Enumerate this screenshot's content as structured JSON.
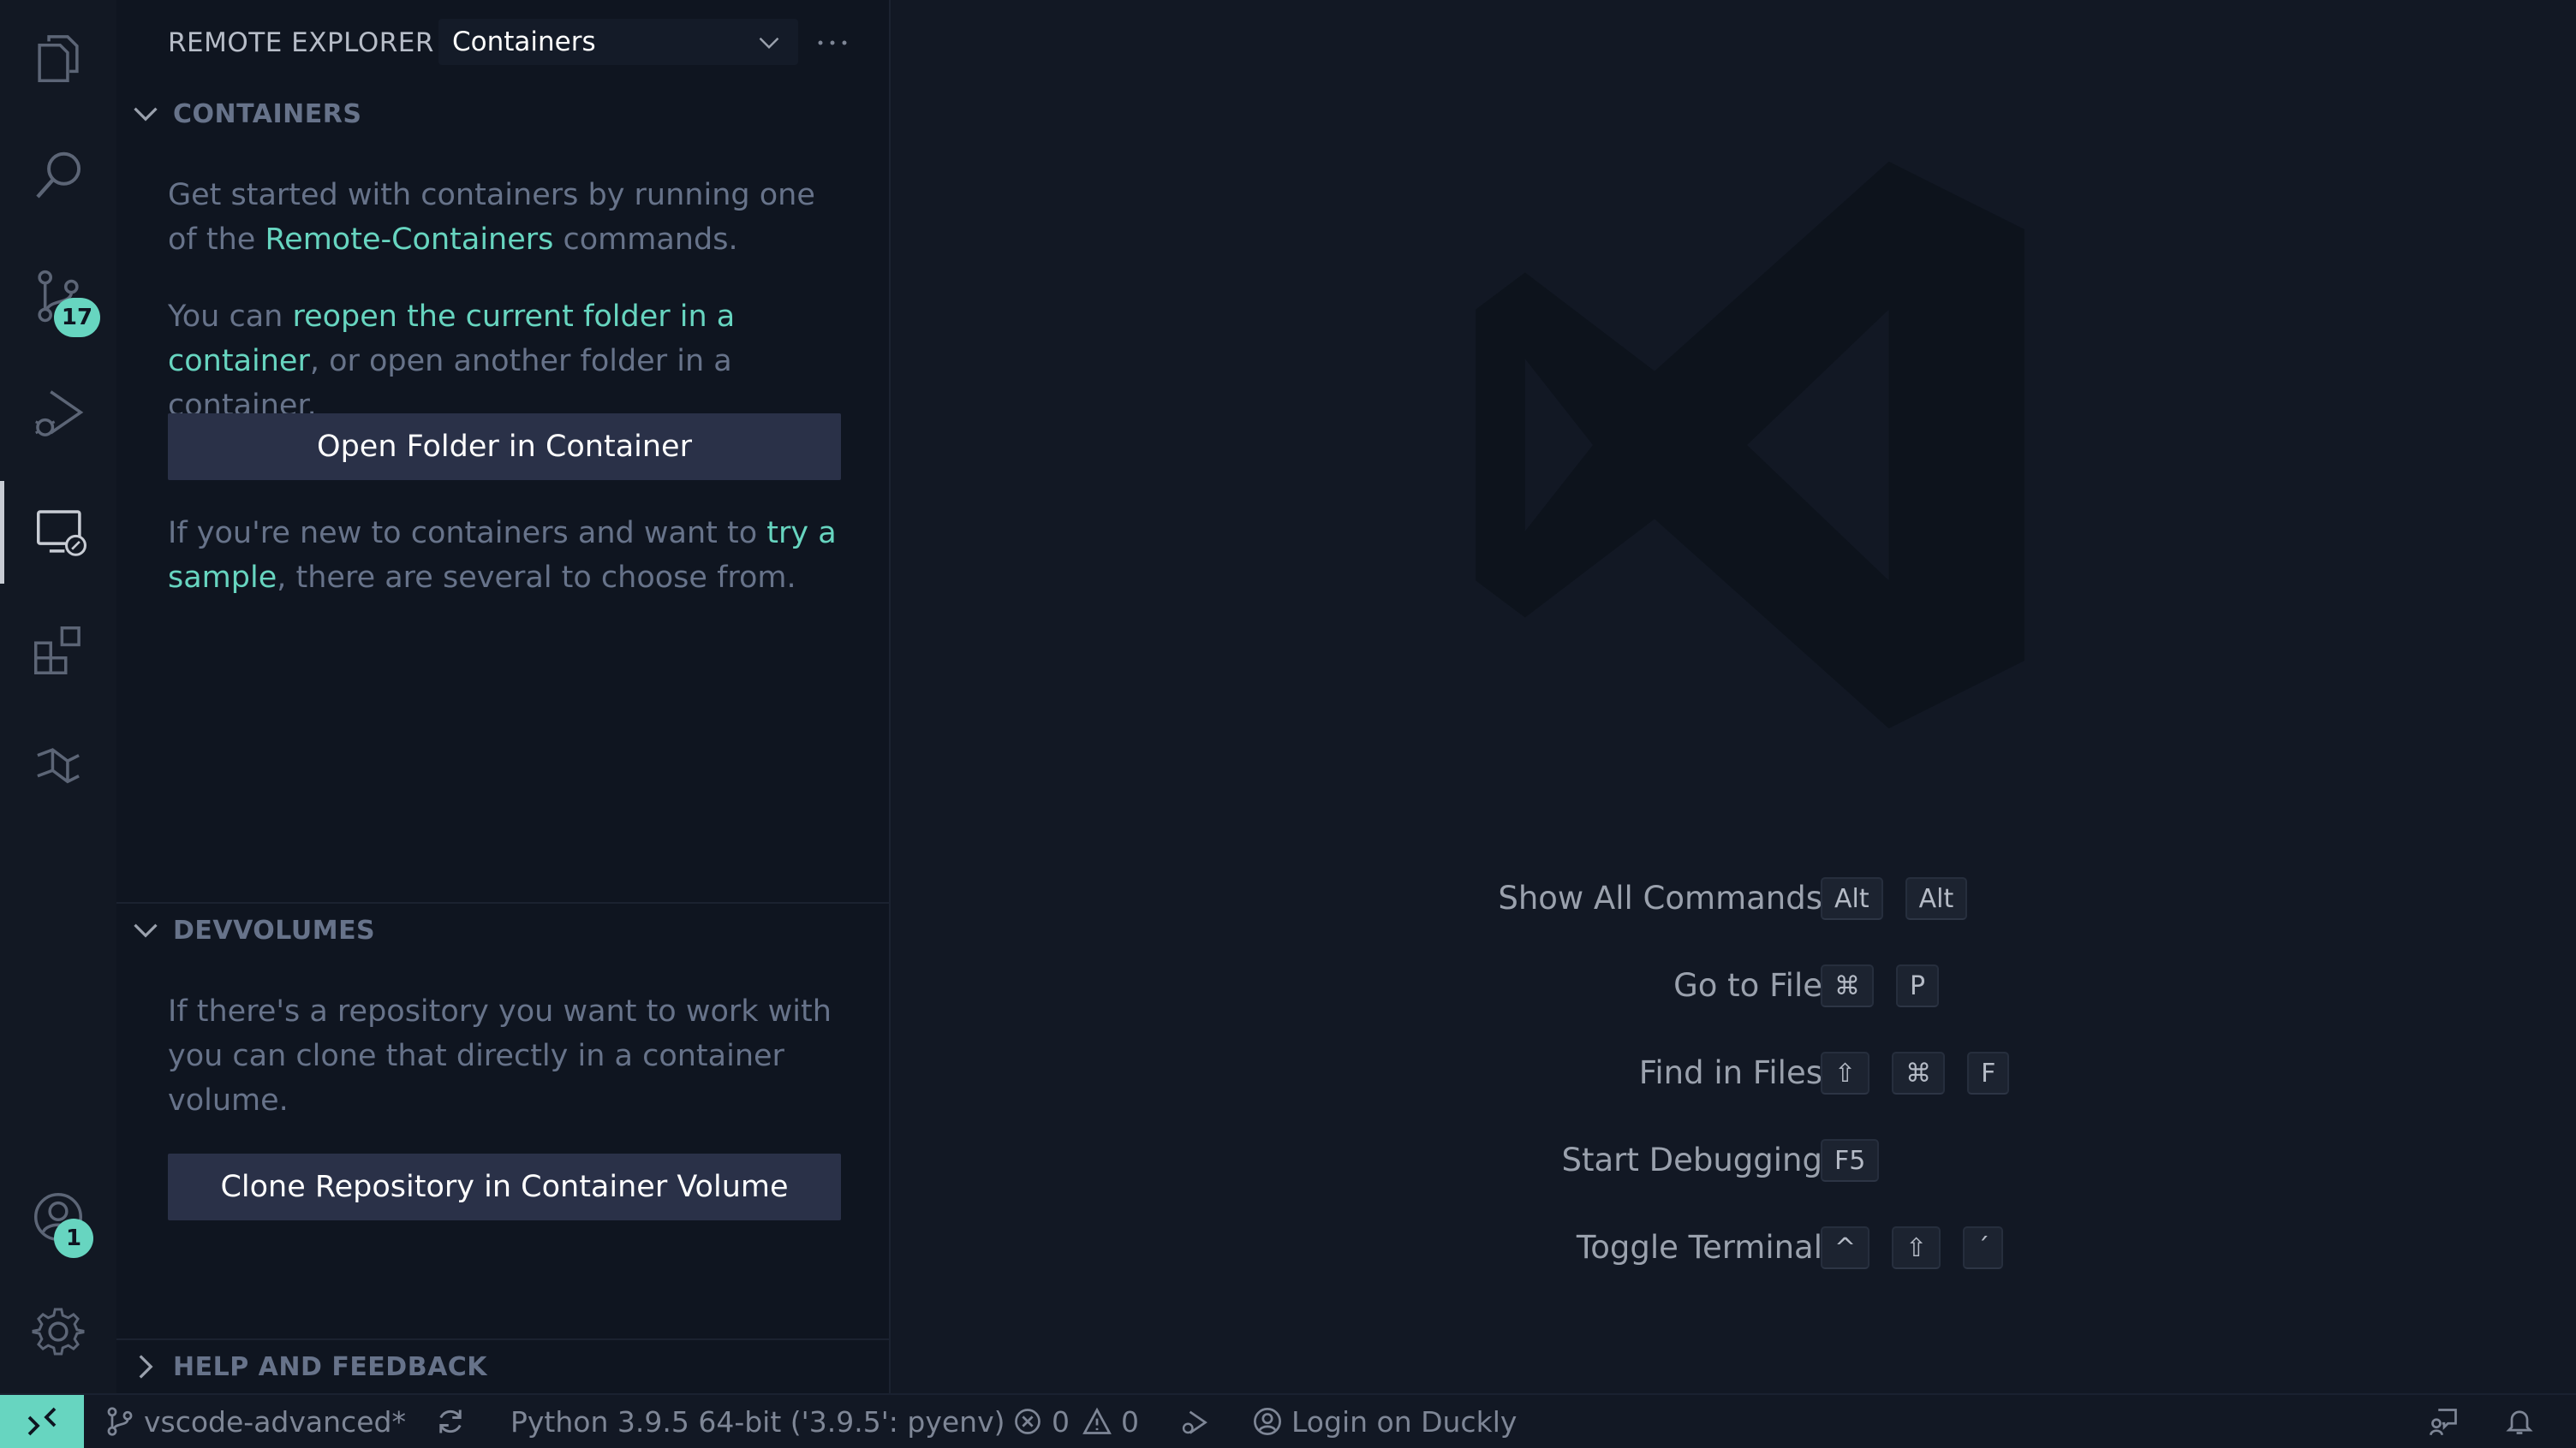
{
  "colors": {
    "accent": "#67d5c0",
    "button_bg": "#2a3148",
    "muted_text": "#67738a"
  },
  "activity_bar": {
    "items": [
      {
        "name": "explorer",
        "icon": "files-icon"
      },
      {
        "name": "search",
        "icon": "search-icon"
      },
      {
        "name": "source-control",
        "icon": "source-control-icon",
        "badge": "17"
      },
      {
        "name": "run-debug",
        "icon": "run-debug-icon"
      },
      {
        "name": "remote-explorer",
        "icon": "remote-explorer-icon",
        "active": true
      },
      {
        "name": "extensions",
        "icon": "extensions-icon"
      },
      {
        "name": "git-graph",
        "icon": "git-graph-icon"
      }
    ],
    "accounts_badge": "1"
  },
  "sidebar": {
    "title": "REMOTE EXPLORER",
    "view_select": "Containers",
    "containers": {
      "header": "CONTAINERS",
      "p1_a": "Get started with containers by running one of the ",
      "p1_link": "Remote-Containers",
      "p1_b": " commands.",
      "p2_a": "You can ",
      "p2_link": "reopen the current folder in a container",
      "p2_b": ", or open another folder in a container.",
      "open_button": "Open Folder in Container",
      "p3_a": "If you're new to containers and want to ",
      "p3_link": "try a sample",
      "p3_b": ", there are several to choose from."
    },
    "devvolumes": {
      "header": "DEVVOLUMES",
      "text": "If there's a repository you want to work with you can clone that directly in a container volume.",
      "clone_button": "Clone Repository in Container Volume"
    },
    "help": {
      "header": "HELP AND FEEDBACK"
    }
  },
  "editor": {
    "shortcuts": [
      {
        "label": "Show All Commands",
        "keys": [
          "Alt",
          "Alt"
        ]
      },
      {
        "label": "Go to File",
        "keys": [
          "⌘",
          "P"
        ]
      },
      {
        "label": "Find in Files",
        "keys": [
          "⇧",
          "⌘",
          "F"
        ]
      },
      {
        "label": "Start Debugging",
        "keys": [
          "F5"
        ]
      },
      {
        "label": "Toggle Terminal",
        "keys": [
          "^",
          "⇧",
          "´"
        ]
      }
    ]
  },
  "status_bar": {
    "branch": "vscode-advanced*",
    "python": "Python 3.9.5 64-bit ('3.9.5': pyenv)",
    "errors": "0",
    "warnings": "0",
    "account": "Login on Duckly"
  }
}
